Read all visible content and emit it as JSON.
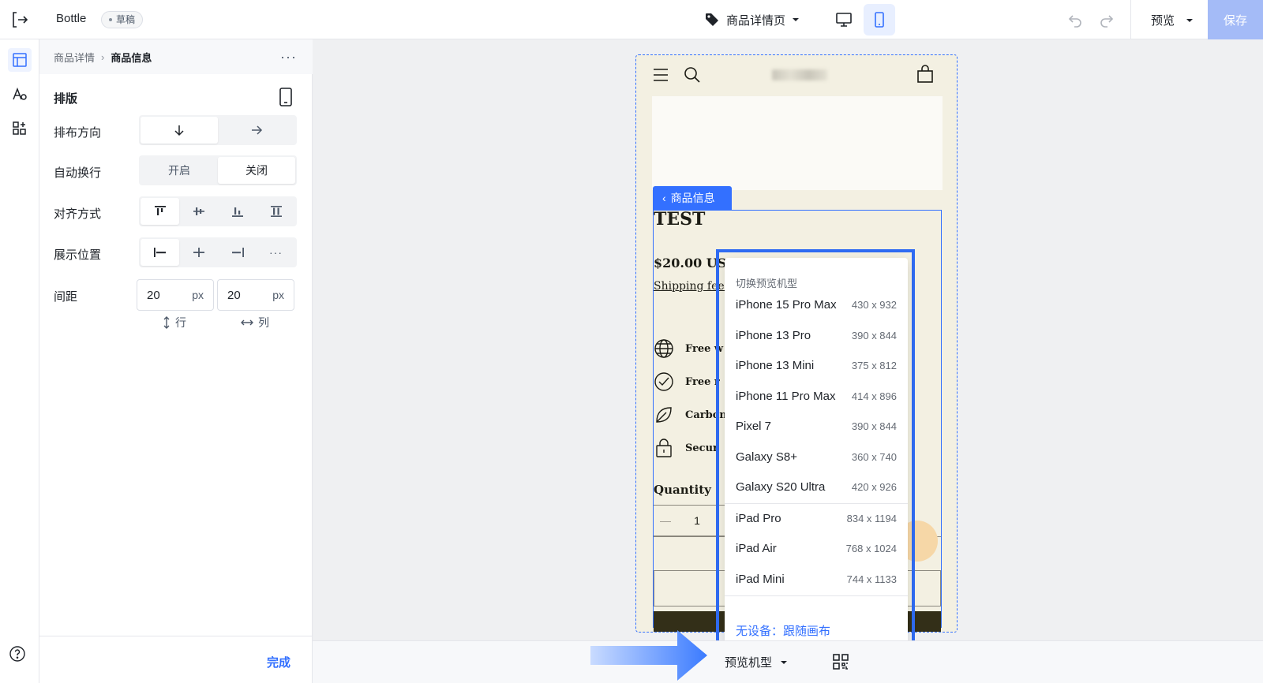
{
  "app": {
    "name": "Bottle",
    "status_badge": "草稿"
  },
  "topbar": {
    "page_selector": "商品详情页",
    "preview_label": "预览",
    "save_label": "保存"
  },
  "panel": {
    "breadcrumb": {
      "parent": "商品详情",
      "current": "商品信息"
    },
    "section_title": "排版",
    "rows": {
      "direction": {
        "label": "排布方向"
      },
      "wrap": {
        "label": "自动换行",
        "options": [
          "开启",
          "关闭"
        ],
        "selected": "关闭"
      },
      "align": {
        "label": "对齐方式"
      },
      "position": {
        "label": "展示位置"
      },
      "spacing": {
        "label": "间距",
        "row_value": "20",
        "col_value": "20",
        "unit": "px",
        "row_label": "行",
        "col_label": "列"
      }
    },
    "done_label": "完成"
  },
  "canvas": {
    "selected_block_tag": "商品信息",
    "product": {
      "title": "TEST",
      "price": "$20.00 USD",
      "shipping": "Shipping fees",
      "features": [
        "Free w",
        "Free r",
        "Carbon",
        "Secur"
      ],
      "quantity_label": "Quantity",
      "quantity_value": "1",
      "quantity_minus": "—"
    }
  },
  "device_menu": {
    "header": "切换预览机型",
    "phones": [
      {
        "name": "iPhone 15 Pro Max",
        "size": "430 x 932"
      },
      {
        "name": "iPhone 13 Pro",
        "size": "390 x 844"
      },
      {
        "name": "iPhone 13 Mini",
        "size": "375 x 812"
      },
      {
        "name": "iPhone 11 Pro Max",
        "size": "414 x 896"
      },
      {
        "name": "Pixel 7",
        "size": "390 x 844"
      },
      {
        "name": "Galaxy S8+",
        "size": "360 x 740"
      },
      {
        "name": "Galaxy S20 Ultra",
        "size": "420 x 926"
      }
    ],
    "tablets": [
      {
        "name": "iPad Pro",
        "size": "834 x 1194"
      },
      {
        "name": "iPad Air",
        "size": "768 x 1024"
      },
      {
        "name": "iPad Mini",
        "size": "744 x 1133"
      }
    ],
    "no_device": "无设备：跟随画布"
  },
  "bottombar": {
    "preview_model_label": "预览机型"
  },
  "colors": {
    "accent": "#3370ff",
    "save_disabled": "#a4bbf7",
    "canvas_bg": "#eff0f2",
    "theme_bg": "#f3f0e2"
  }
}
